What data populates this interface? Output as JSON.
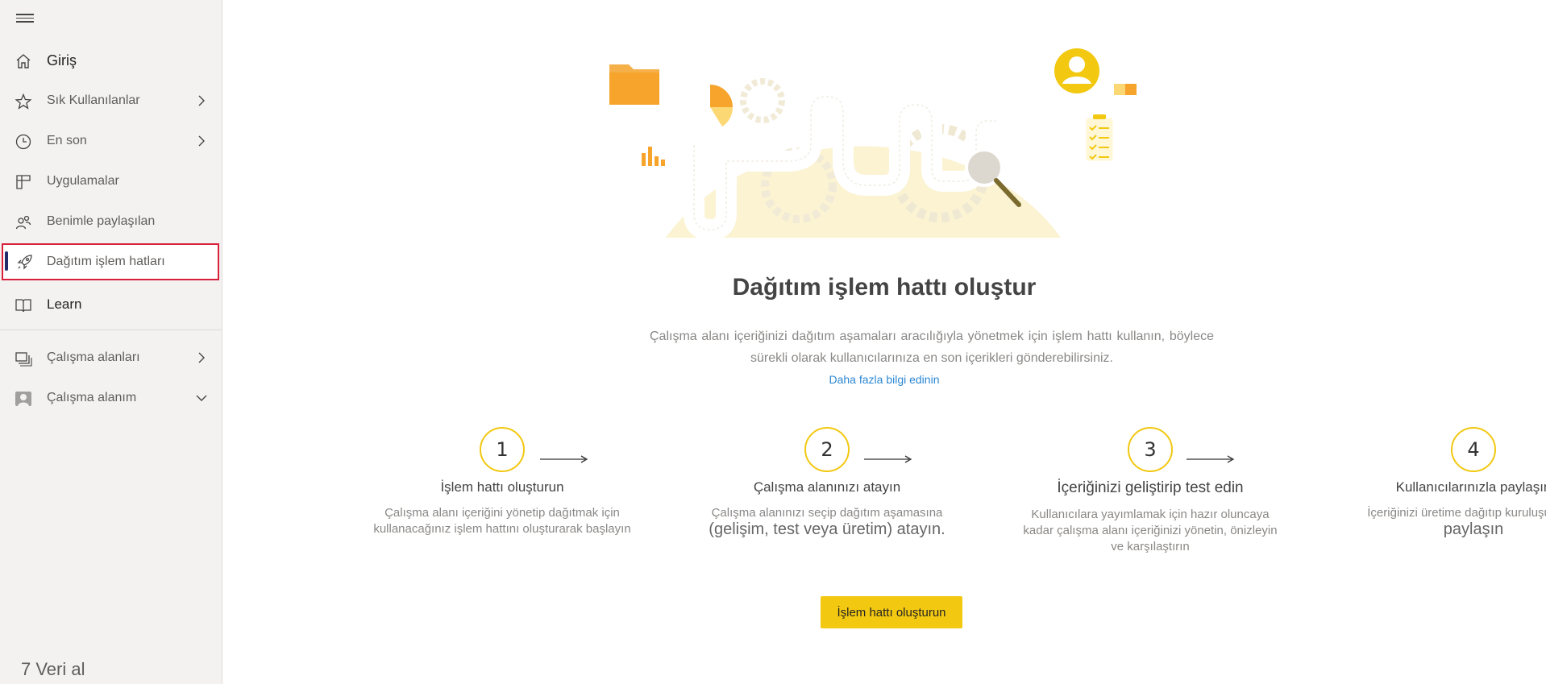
{
  "sidebar": {
    "items": [
      {
        "label": "Giriş",
        "icon": "home-icon"
      },
      {
        "label": "Sık Kullanılanlar",
        "icon": "star-icon"
      },
      {
        "label": "En son",
        "icon": "clock-icon"
      },
      {
        "label": "Uygulamalar",
        "icon": "apps-icon"
      },
      {
        "label": "Benimle paylaşılan",
        "icon": "shared-icon"
      },
      {
        "label": "Dağıtım işlem hatları",
        "icon": "rocket-icon"
      },
      {
        "label": "Learn",
        "icon": "book-icon"
      },
      {
        "label": "Çalışma alanları",
        "icon": "workspaces-icon"
      },
      {
        "label": "Çalışma alanım",
        "icon": "my-workspace-icon"
      }
    ],
    "get_data": "7 Veri al"
  },
  "main": {
    "title": "Dağıtım işlem hattı oluştur",
    "description": "Çalışma alanı içeriğinizi dağıtım aşamaları aracılığıyla yönetmek için işlem hattı kullanın, böylece sürekli olarak kullanıcılarınıza en son içerikleri gönderebilirsiniz.",
    "learn_more": "Daha fazla bilgi edinin",
    "steps": [
      {
        "number": "1",
        "title": "İşlem hattı oluşturun",
        "desc": "Çalışma alanı içeriğini yönetip dağıtmak için kullanacağınız işlem hattını oluşturarak başlayın"
      },
      {
        "number": "2",
        "title": "Çalışma alanınızı atayın",
        "desc": "Çalışma alanınızı seçip dağıtım aşamasına",
        "desc_big": "(gelişim, test veya üretim) atayın."
      },
      {
        "number": "3",
        "title": "İçeriğinizi geliştirip test edin",
        "desc": "Kullanıcılara yayımlamak için hazır oluncaya kadar çalışma alanı içeriğinizi yönetin, önizleyin ve karşılaştırın"
      },
      {
        "number": "4",
        "title": "Kullanıcılarınızla paylaşın",
        "desc": "İçeriğinizi üretime dağıtıp kuruluşunuzla",
        "desc_big": "paylaşın"
      }
    ],
    "cta_label": "İşlem hattı oluşturun"
  },
  "colors": {
    "accent": "#f2c811",
    "active_bar": "#1f2b6b",
    "highlight": "#d9203b",
    "link": "#2b87d3"
  }
}
